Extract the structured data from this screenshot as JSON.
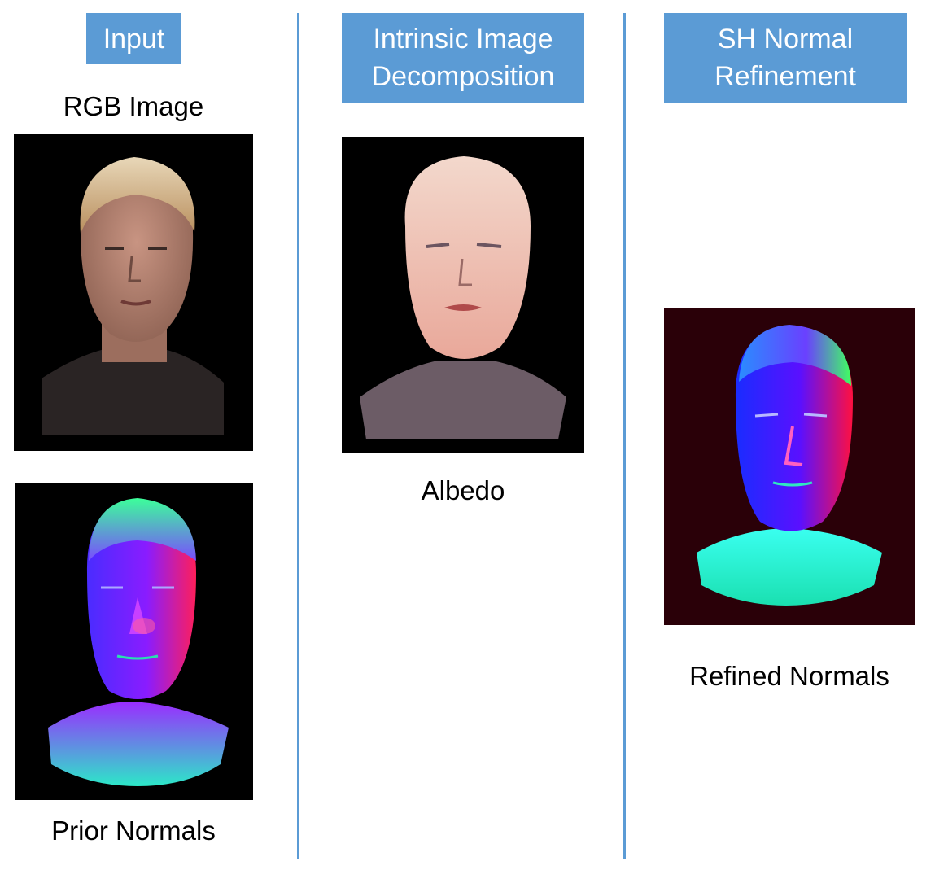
{
  "columns": [
    {
      "header": "Input"
    },
    {
      "header": "Intrinsic Image\nDecomposition"
    },
    {
      "header": "SH Normal\nRefinement"
    }
  ],
  "captions": {
    "rgb": "RGB Image",
    "prior": "Prior Normals",
    "albedo": "Albedo",
    "refined": "Refined Normals"
  },
  "colors": {
    "header_bg": "#5b9bd5",
    "divider": "#5b9bd5",
    "panel_bg": "#000000",
    "refined_bg": "#2a0008"
  }
}
